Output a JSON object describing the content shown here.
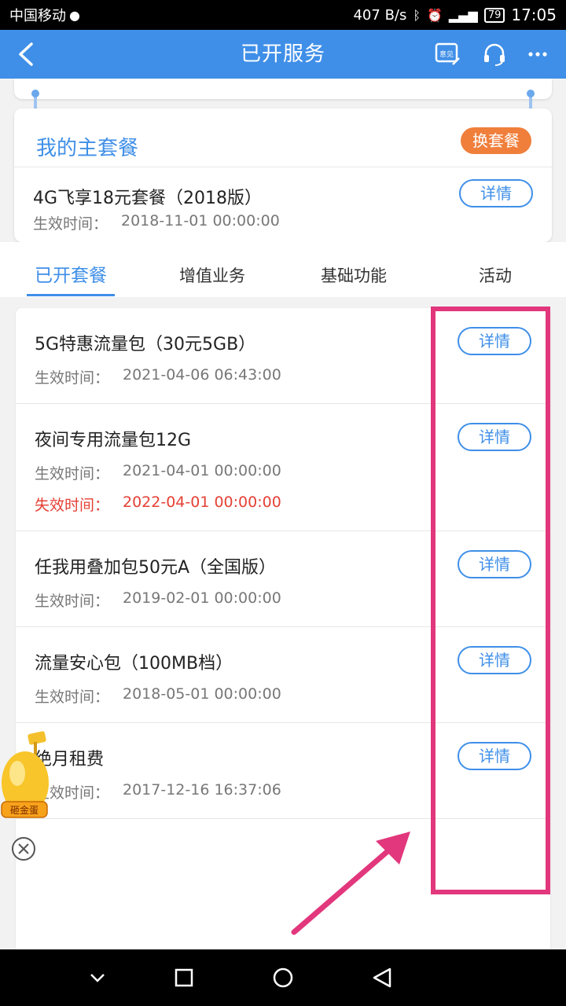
{
  "status_bar": {
    "carrier": "中国移动",
    "net_speed": "407 B/s",
    "battery": "79",
    "time": "17:05"
  },
  "app_bar": {
    "title": "已开服务",
    "icons": [
      "back-icon",
      "feedback-icon",
      "headset-icon",
      "more-icon"
    ],
    "feedback_icon_text": "意见"
  },
  "main_package": {
    "section_title": "我的主套餐",
    "swap_label": "换套餐",
    "name": "4G飞享18元套餐（2018版）",
    "effective_label": "生效时间：",
    "effective_time": "2018-11-01  00:00:00",
    "detail_label": "详情"
  },
  "tabs": [
    {
      "label": "已开套餐",
      "active": true
    },
    {
      "label": "增值业务",
      "active": false
    },
    {
      "label": "基础功能",
      "active": false
    },
    {
      "label": "活动",
      "active": false
    }
  ],
  "packages": [
    {
      "name": "5G特惠流量包（30元5GB）",
      "effective_label": "生效时间：",
      "effective_time": "2021-04-06  06:43:00",
      "detail_label": "详情"
    },
    {
      "name": "夜间专用流量包12G",
      "effective_label": "生效时间：",
      "effective_time": "2021-04-01  00:00:00",
      "expire_label": "失效时间：",
      "expire_time": "2022-04-01  00:00:00",
      "detail_label": "详情"
    },
    {
      "name": "任我用叠加包50元A（全国版）",
      "effective_label": "生效时间：",
      "effective_time": "2019-02-01  00:00:00",
      "detail_label": "详情"
    },
    {
      "name": "流量安心包（100MB档）",
      "effective_label": "生效时间：",
      "effective_time": "2018-05-01  00:00:00",
      "detail_label": "详情"
    },
    {
      "name": "绝月租费",
      "effective_label": "生效时间：",
      "effective_time": "2017-12-16  16:37:06",
      "detail_label": "详情"
    }
  ],
  "floating": {
    "egg_label": "砸金蛋",
    "icons": [
      "golden-egg-icon",
      "close-circle-icon"
    ]
  },
  "annotation": {
    "color": "#e2377c"
  },
  "nav_bar": {
    "icons": [
      "nav-down-icon",
      "nav-recent-icon",
      "nav-home-icon",
      "nav-back-icon"
    ]
  },
  "colors": {
    "primary": "#3f8fe8",
    "accent_orange": "#f07f3c",
    "expire_red": "#e54035"
  }
}
